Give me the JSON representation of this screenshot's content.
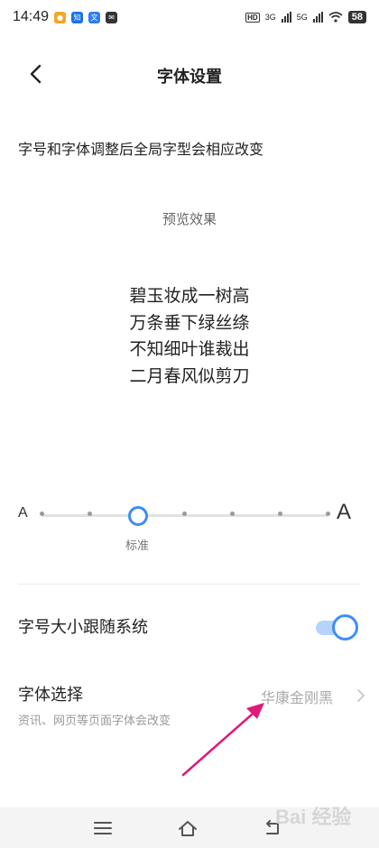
{
  "status_bar": {
    "time": "14:49",
    "notification_icons": [
      "weibo-icon",
      "zhihu-icon",
      "translate-icon",
      "message-icon"
    ],
    "hd_label": "HD",
    "network_1": "3G",
    "network_2": "5G",
    "battery": "58"
  },
  "header": {
    "title": "字体设置"
  },
  "description": "字号和字体调整后全局字型会相应改变",
  "preview": {
    "label": "预览效果",
    "poem_lines": [
      "碧玉妆成一树高",
      "万条垂下绿丝绦",
      "不知细叶谁裁出",
      "二月春风似剪刀"
    ]
  },
  "font_size_slider": {
    "small_label": "A",
    "large_label": "A",
    "caption": "标准",
    "levels": 7,
    "selected_index": 2
  },
  "follow_system": {
    "label": "字号大小跟随系统",
    "enabled": true
  },
  "font_select": {
    "label": "字体选择",
    "description": "资讯、网页等页面字体会改变",
    "value": "华康金刚黑"
  },
  "watermark": "Bai 经验",
  "colors": {
    "accent": "#3d8ef5",
    "annotation_arrow": "#e0197a"
  }
}
